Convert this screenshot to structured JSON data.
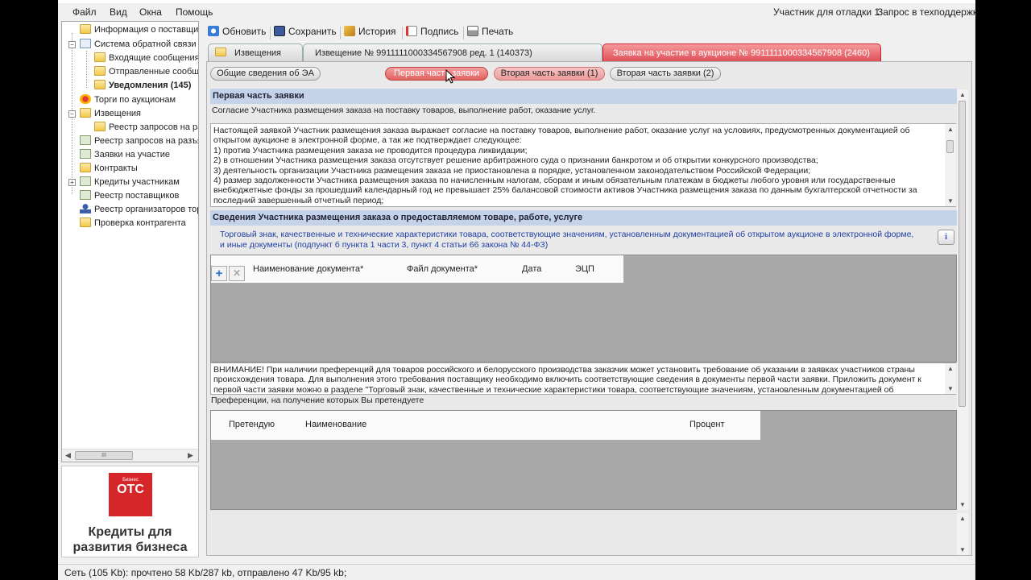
{
  "menu": [
    "Файл",
    "Вид",
    "Окна",
    "Помощь"
  ],
  "top_right": {
    "user": "Участник для отладки 1",
    "support": "Запрос в техподдержку"
  },
  "sidebar": {
    "items": [
      {
        "label": "Информация о поставщиках",
        "icon": "folder-icon"
      },
      {
        "label": "Система обратной связи",
        "icon": "envelope-icon"
      },
      {
        "label": "Входящие сообщения",
        "icon": "folder-icon"
      },
      {
        "label": "Отправленные сообщения",
        "icon": "folder-icon"
      },
      {
        "label": "Уведомления (145)",
        "icon": "folder-icon"
      },
      {
        "label": "Торги по аукционам",
        "icon": "auction-icon"
      },
      {
        "label": "Извещения",
        "icon": "folder-icon"
      },
      {
        "label": "Реестр запросов на разъяснения",
        "icon": "folder-icon"
      },
      {
        "label": "Реестр запросов на разъяснения",
        "icon": "check-icon"
      },
      {
        "label": "Заявки на участие",
        "icon": "check-icon"
      },
      {
        "label": "Контракты",
        "icon": "folder-icon"
      },
      {
        "label": "Кредиты участникам",
        "icon": "check-icon"
      },
      {
        "label": "Реестр поставщиков",
        "icon": "registry-icon"
      },
      {
        "label": "Реестр организаторов торгов",
        "icon": "person-icon"
      },
      {
        "label": "Проверка контрагента",
        "icon": "registry-icon"
      }
    ],
    "scroll_thumb": "III"
  },
  "ad": {
    "logo_small": "Бизнес",
    "logo_big": "ОТС",
    "text_line1": "Кредиты для",
    "text_line2": "развития бизнеса"
  },
  "toolbar": {
    "refresh": "Обновить",
    "save": "Сохранить",
    "history": "История",
    "sign": "Подпись",
    "print": "Печать"
  },
  "doc_tabs": {
    "notices": "Извещения",
    "notice": "Извещение № 9911111000334567908 ред. 1 (140373)",
    "application": "Заявка на участие в аукционе № 9911111000334567908 (2460)"
  },
  "sub_tabs": {
    "general": "Общие сведения об ЭА",
    "first_part": "Первая часть заявки",
    "second_part_1": "Вторая часть заявки (1)",
    "second_part_2": "Вторая часть заявки (2)"
  },
  "section1": {
    "header": "Первая часть заявки",
    "consent": "Согласие Участника размещения заказа на поставку товаров, выполнение работ, оказание услуг.",
    "body_lines": [
      "Настоящей заявкой Участник размещения заказа выражает согласие на поставку товаров, выполнение работ, оказание услуг на условиях, предусмотренных документацией об",
      "открытом аукционе в электронной форме, а так же подтверждает следующее:",
      "1) против Участника размещения заказа не проводится процедура ликвидации;",
      "2) в отношении Участника размещения заказа отсутствует решение арбитражного суда о признании банкротом и об открытии конкурсного производства;",
      "3) деятельность организации Участника размещения заказа не приостановлена в порядке, установленном законодательством Российской Федерации;",
      "4) размер задолженности Участника размещения заказа по начисленным налогам, сборам и иным обязательным платежам в бюджеты любого уровня или государственные",
      "внебюджетные фонды за прошедший календарный год не превышает 25% балансовой стоимости активов Участника размещения заказа по данным бухгалтерской отчетности за",
      "последний завершенный отчетный период;"
    ]
  },
  "section2": {
    "header": "Сведения Участника размещения заказа о предоставляемом товаре, работе, услуге",
    "info_line1": "Торговый знак, качественные и технические характеристики товара, соответствующие значениям, установленным документацией об открытом аукционе в электронной форме,",
    "info_line2": "и иные документы (подпункт б пункта 1 части 3, пункт 4 статьи 66 закона № 44-ФЗ)",
    "info_button": "i",
    "doc_columns": [
      "Наименование документа*",
      "Файл документа*",
      "Дата",
      "ЭЦП"
    ],
    "add_button": "+",
    "delete_button": "✕",
    "warning_lines": [
      "ВНИМАНИЕ! При наличии преференций для товаров российского и белорусского производства заказчик может установить требование об указании в заявках участников страны",
      "происхождения товара. Для выполнения этого требования поставщику необходимо включить соответствующие сведения в документы первой части заявки. Приложить документ к",
      "первой части заявки можно в разделе \"Торговый знак, качественные и технические характеристики товара, соответствующие значениям, установленным документацией об"
    ],
    "preferences_label": "Преференции, на получение которых Вы претендуете",
    "pref_columns": [
      "Претендую",
      "Наименование",
      "Процент"
    ]
  },
  "statusbar": "Сеть (105 Kb):  прочтено 58 Kb/287 kb, отправлено 47 Kb/95 kb;"
}
